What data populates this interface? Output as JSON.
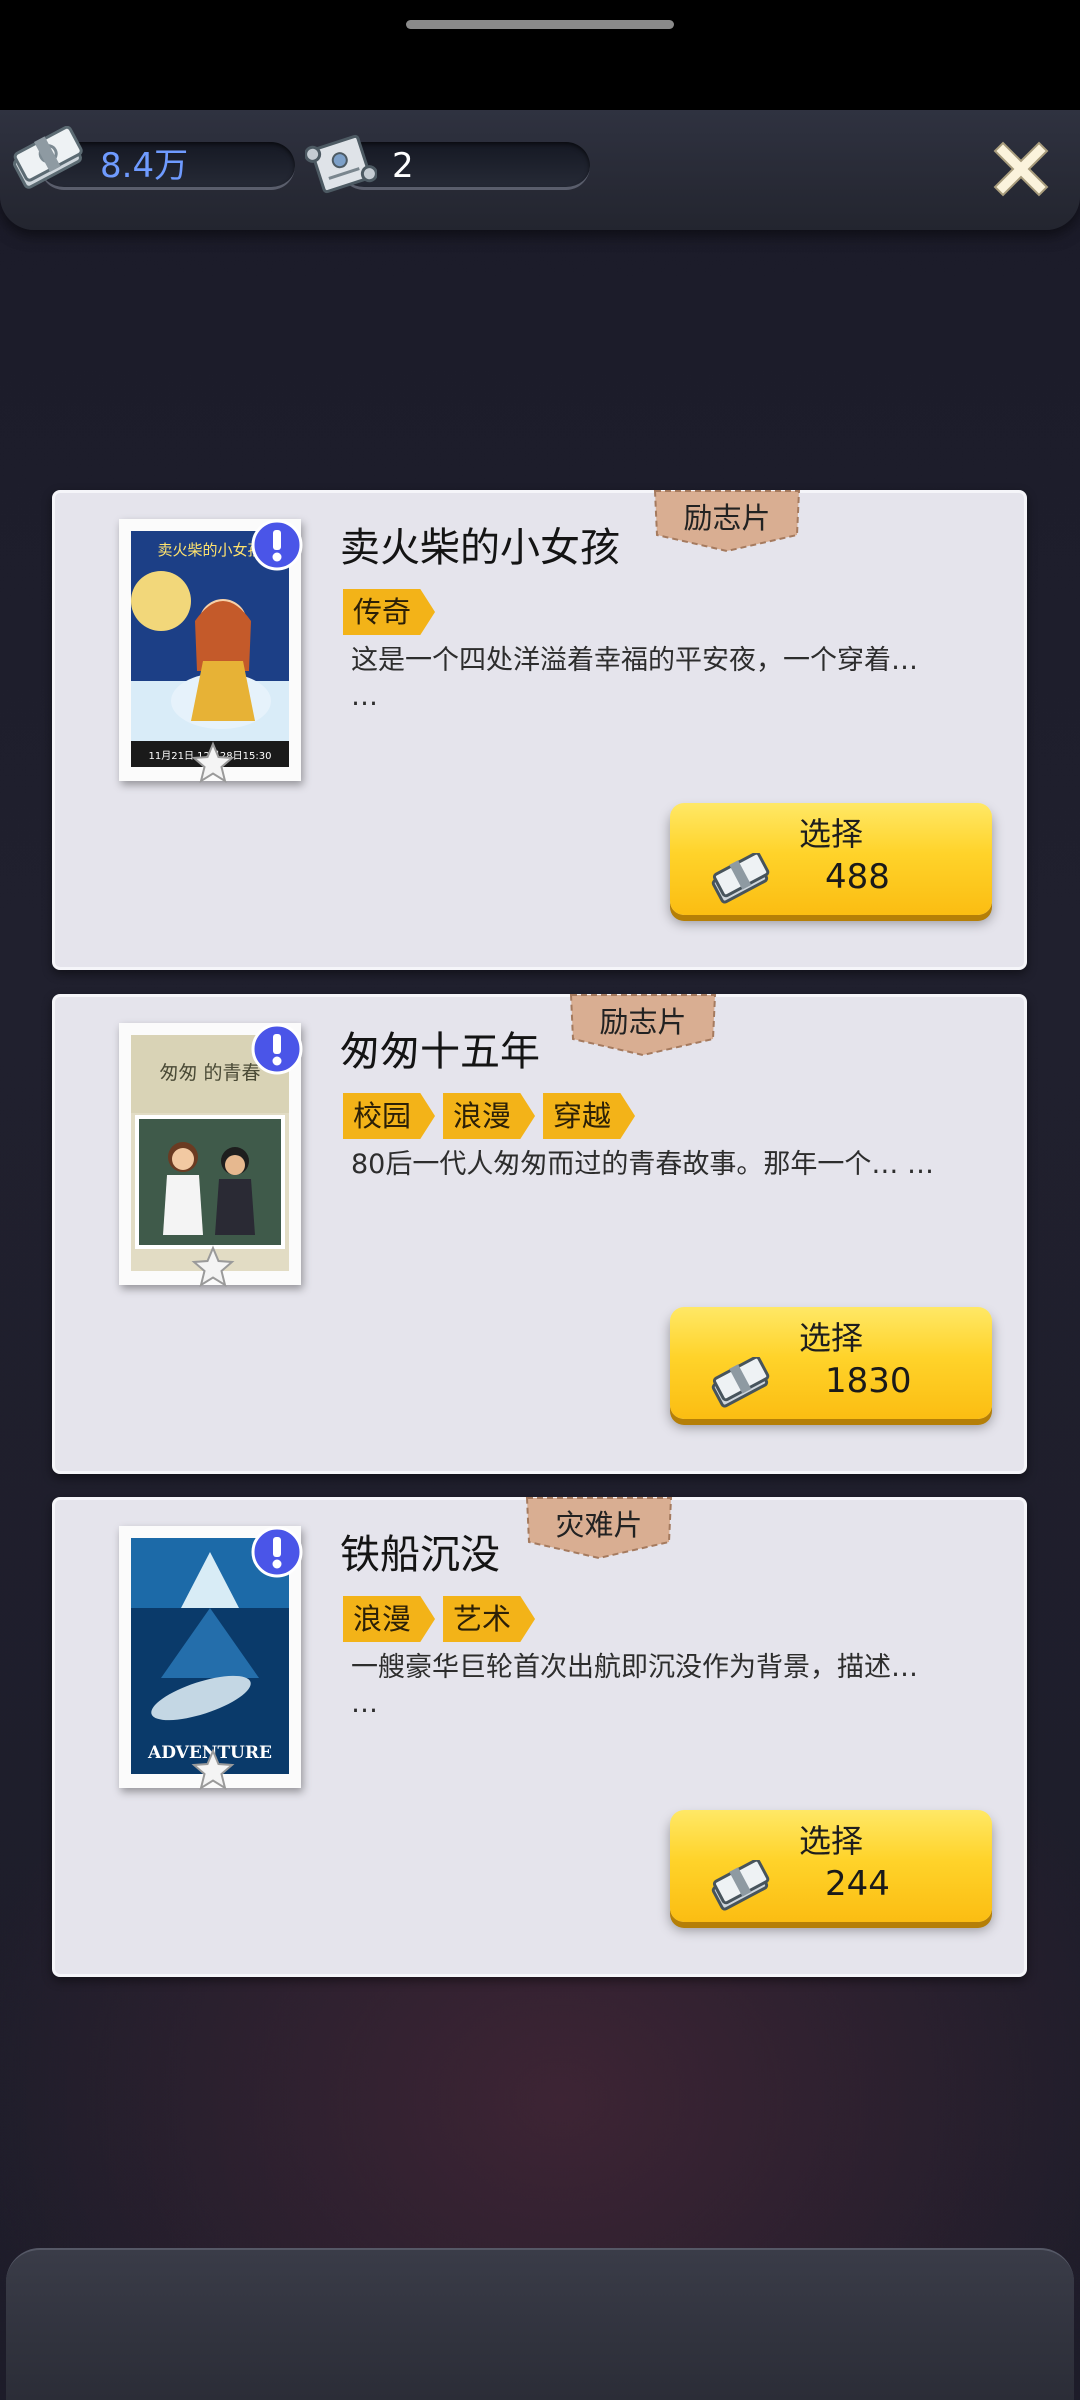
{
  "header": {
    "money": "8.4万",
    "tickets": "2"
  },
  "select_label": "选择",
  "movies": [
    {
      "title": "卖火柴的小女孩",
      "genre": "励志片",
      "tags": [
        "传奇"
      ],
      "description": "这是一个四处洋溢着幸福的平安夜，一个穿着…\n…",
      "price": "488",
      "poster_title": "卖火柴的小女孩",
      "poster_footer": "11月21日 12月28日15:30"
    },
    {
      "title": "匆匆十五年",
      "genre": "励志片",
      "tags": [
        "校园",
        "浪漫",
        "穿越"
      ],
      "description": "80后一代人匆匆而过的青春故事。那年一个… …",
      "price": "1830",
      "poster_title": "匆匆 的青春"
    },
    {
      "title": "铁船沉没",
      "genre": "灾难片",
      "tags": [
        "浪漫",
        "艺术"
      ],
      "description": "一艘豪华巨轮首次出航即沉没作为背景，描述…\n…",
      "price": "244",
      "poster_title": "ADVENTURE"
    }
  ],
  "colors": {
    "tag": "#f3b318",
    "button": "#ffd32a",
    "card": "#e5e4ec",
    "info_badge": "#4a55e8",
    "money_text": "#6f9bff"
  },
  "icons": {
    "money": "money-stack-icon",
    "ticket": "scroll-ticket-icon",
    "close": "close-icon",
    "info": "exclamation-icon",
    "star": "star-icon"
  }
}
